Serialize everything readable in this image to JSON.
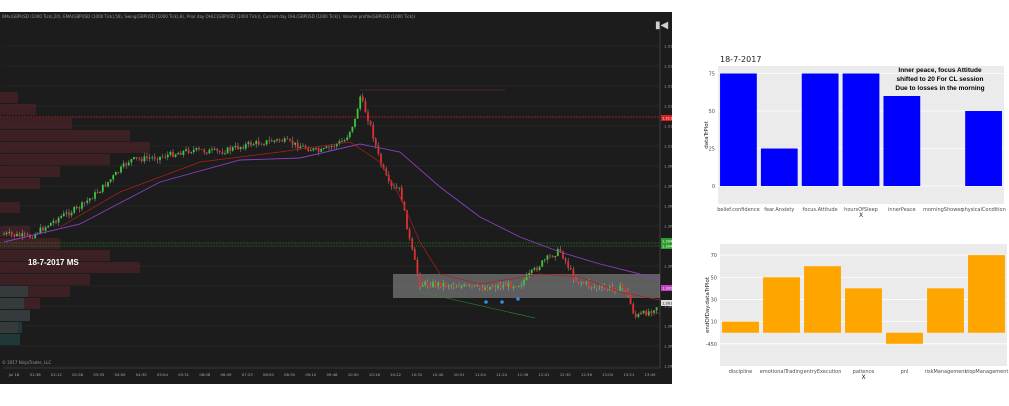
{
  "trading_chart": {
    "header": "6Ma(GBPUSD (1000 Tick),20), EMA(GBPUSD (1000 Tick),50), Swing(GBPUSD (1000 Tick),8), Prior day OHLC(GBPUSD (1000 Tick)), Current day OHL(GBPUSD (1000 Tick)), Volume profile(GBPUSD (1000 Tick))",
    "annotation": "18-7-2017 MS",
    "copyright": "© 2017 NinjaTrader, LLC",
    "price_ticks": [
      "1.31570",
      "1.31470",
      "1.31370",
      "1.31270",
      "1.31170",
      "1.31070",
      "1.30970",
      "1.30870",
      "1.30770",
      "1.30670",
      "1.30570",
      "1.30470",
      "1.30370",
      "1.30270",
      "1.30170",
      "1.30070",
      "1.29970"
    ],
    "price_tags": [
      {
        "label": "1.31130",
        "color": "#d62020"
      },
      {
        "label": "1.30487",
        "color": "#2e9e2e"
      },
      {
        "label": "1.30457",
        "color": "#2e9e2e"
      },
      {
        "label": "1.30239",
        "color": "#c040c0"
      },
      {
        "label": "1.30179",
        "color": "#1c1c1c"
      }
    ],
    "time_ticks": [
      "Jul 18",
      "01:38",
      "02:12",
      "02:58",
      "03:35",
      "04:00",
      "04:30",
      "05:04",
      "05:31",
      "06:08",
      "06:49",
      "07:23",
      "08:00",
      "08:30",
      "09:10",
      "09:48",
      "10:00",
      "10:16",
      "10:22",
      "10:32",
      "10:40",
      "10:51",
      "11:04",
      "11:24",
      "11:36",
      "12:01",
      "12:30",
      "12:36",
      "13:04",
      "13:21",
      "13:49"
    ]
  },
  "chart_data": [
    {
      "type": "bar",
      "title": "18-7-2017",
      "annotation_lines": [
        "Inner peace, focus Attitude",
        "shifted to 20 For CL session",
        "Due to losses in the morning"
      ],
      "xlabel": "X",
      "ylabel": "dataTrPlot",
      "categories": [
        "belief.confidence",
        "fear.Anxiety",
        "focus.Attitude",
        "hoursOfSleep",
        "innerPeace",
        "morningShower",
        "physicalCondition"
      ],
      "values": [
        75,
        25,
        75,
        75,
        60,
        0,
        50
      ],
      "ylim": [
        -12,
        80
      ],
      "yticks": [
        0,
        25,
        50,
        75
      ],
      "color": "#0000ff",
      "grid": true
    },
    {
      "type": "bar",
      "xlabel": "X",
      "ylabel": "endOfDay.dataTrPlot",
      "categories": [
        "discipline",
        "emotionalTrading",
        "entryExecution",
        "patience",
        "pnl",
        "riskManagement",
        "stopManagement"
      ],
      "values": [
        10,
        50,
        60,
        40,
        -450,
        40,
        70
      ],
      "value_positions": [
        10,
        50,
        60,
        40,
        -10,
        40,
        70
      ],
      "ylim": [
        -30,
        80
      ],
      "yticks": [
        "-450",
        "10",
        "30",
        "50",
        "70"
      ],
      "ytick_positions": [
        -10,
        10,
        30,
        50,
        70
      ],
      "color": "#ffa500",
      "grid": true
    }
  ]
}
